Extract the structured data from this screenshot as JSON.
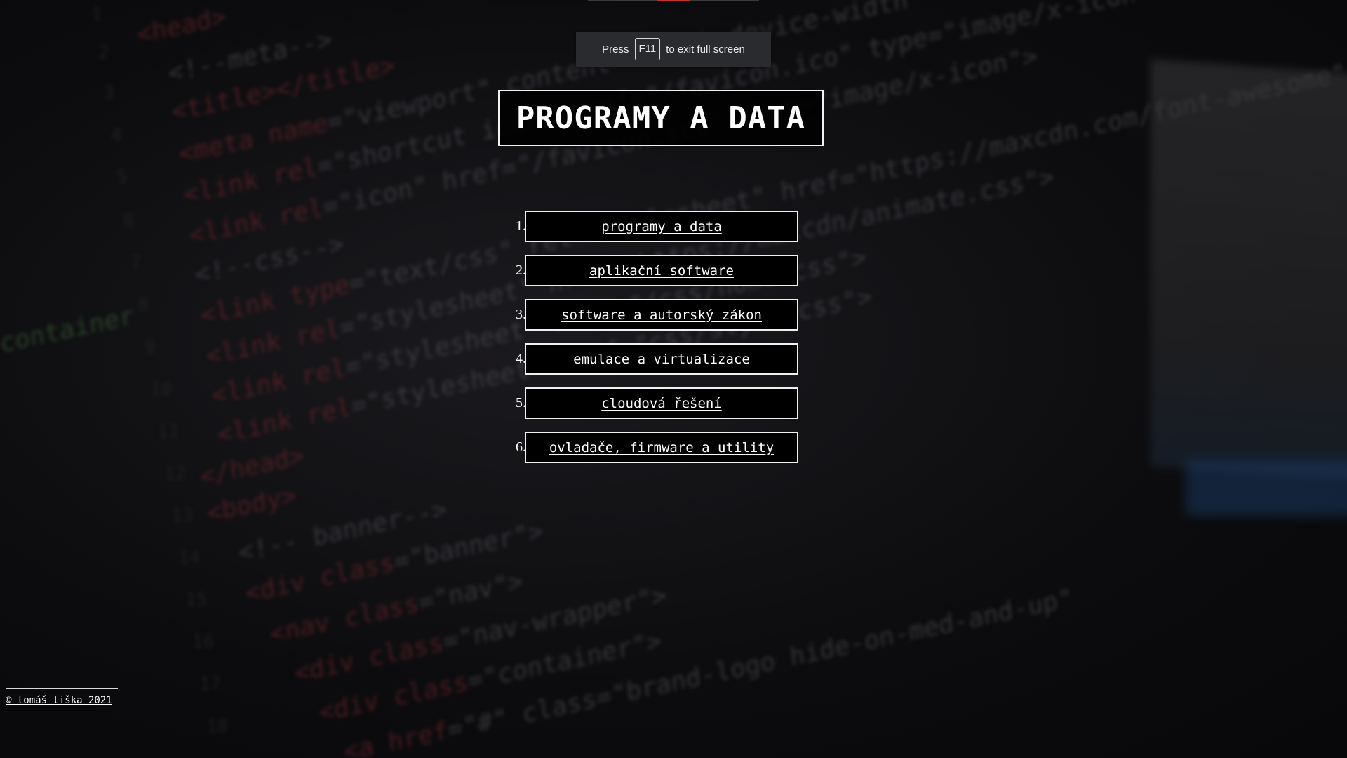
{
  "fullscreen_notice": {
    "prefix": "Press",
    "key": "F11",
    "suffix": "to exit full screen"
  },
  "page": {
    "title": "PROGRAMY A DATA"
  },
  "menu": {
    "items": [
      {
        "number": "1.",
        "label": "programy a data"
      },
      {
        "number": "2.",
        "label": "aplikační software"
      },
      {
        "number": "3.",
        "label": "software a autorský zákon"
      },
      {
        "number": "4.",
        "label": "emulace a virtualizace"
      },
      {
        "number": "5.",
        "label": "cloudová řešení"
      },
      {
        "number": "6.",
        "label": "ovladače, firmware a utility"
      }
    ]
  },
  "footer": {
    "copyright": "© tomáš liška 2021"
  },
  "colors": {
    "background": "#0b0b0d",
    "box_border": "#f0f0f0",
    "text": "#ffffff",
    "notice_bg": "#2a2b2e"
  }
}
